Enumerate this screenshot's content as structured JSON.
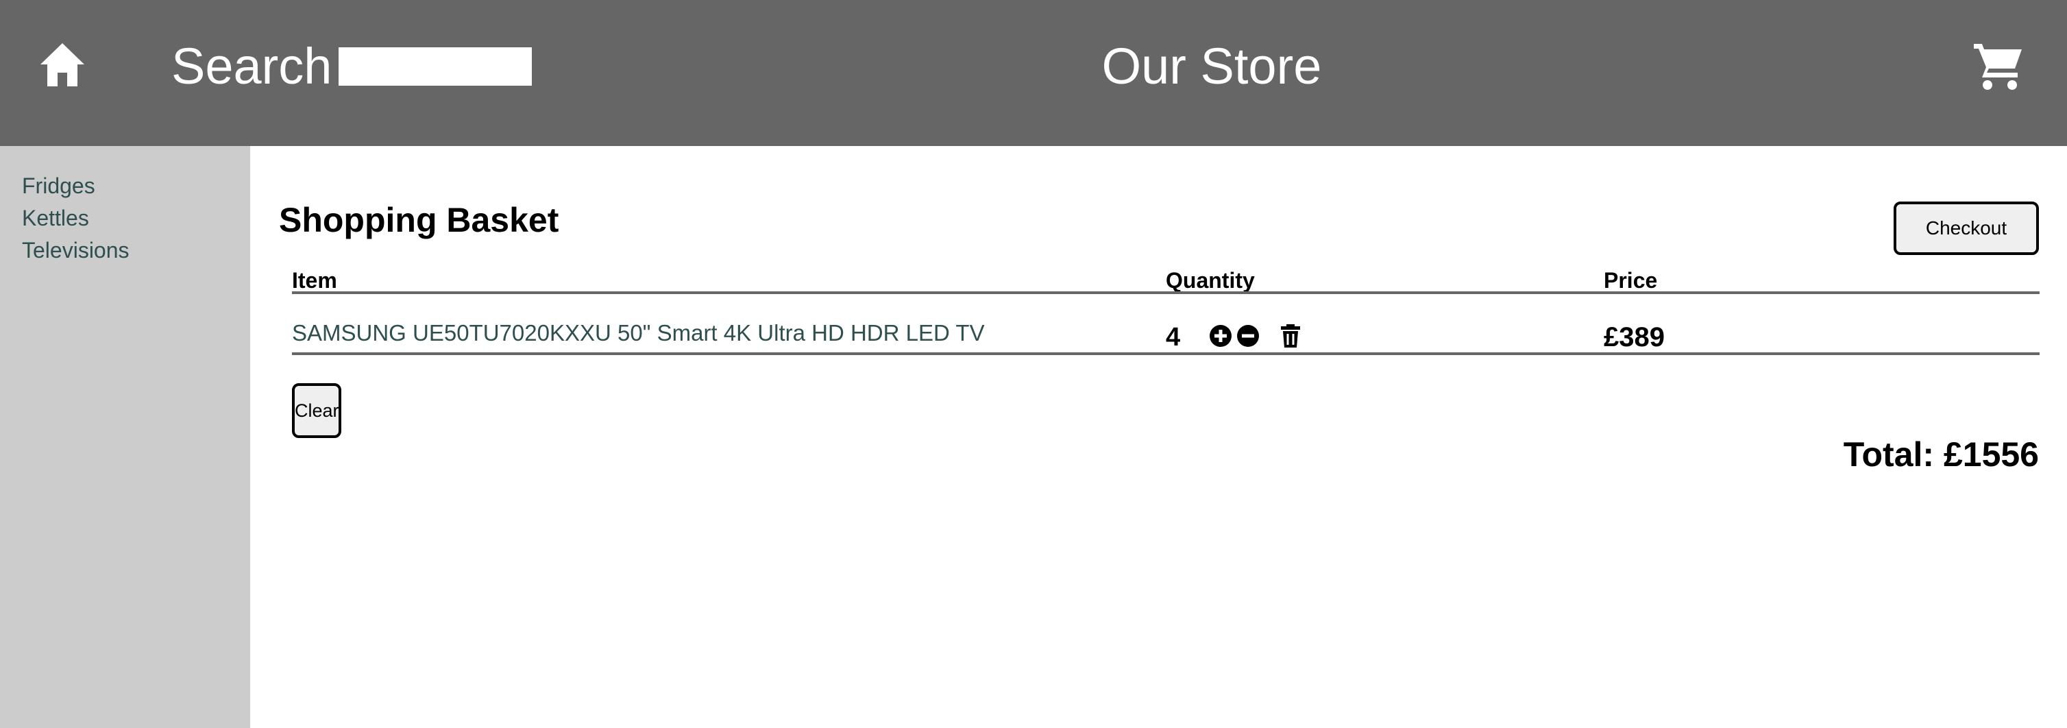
{
  "header": {
    "search_label": "Search",
    "search_value": "",
    "title": "Our Store",
    "home_icon": "home-icon",
    "cart_icon": "shopping-cart-icon"
  },
  "sidebar": {
    "items": [
      {
        "label": "Fridges"
      },
      {
        "label": "Kettles"
      },
      {
        "label": "Televisions"
      }
    ]
  },
  "basket": {
    "title": "Shopping Basket",
    "checkout_label": "Checkout",
    "columns": [
      "Item",
      "Quantity",
      "Price"
    ],
    "rows": [
      {
        "item": "SAMSUNG UE50TU7020KXXU 50\" Smart 4K Ultra HD HDR LED TV",
        "quantity": "4",
        "price": "£389",
        "icons": [
          "plus-circle-icon",
          "minus-circle-icon",
          "trash-icon"
        ]
      }
    ],
    "clear_label": "Clear",
    "total": "Total: £1556"
  },
  "colors": {
    "header_bg": "#666666",
    "sidebar_bg": "#cccccc",
    "link": "#2f4f4f",
    "button_bg": "#efefef"
  }
}
